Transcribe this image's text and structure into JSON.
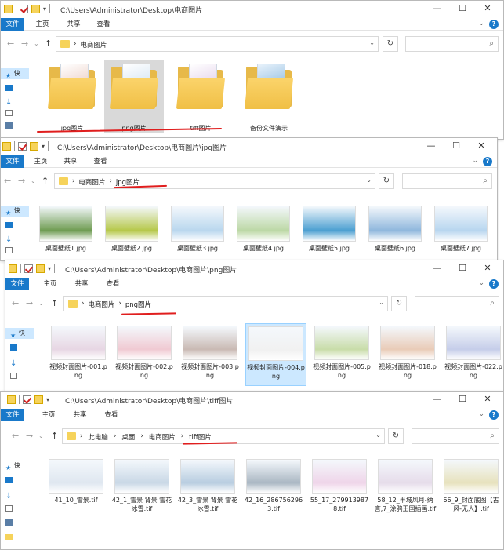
{
  "ribbon": {
    "file": "文件",
    "home": "主页",
    "share": "共享",
    "view": "查看",
    "help": "?"
  },
  "window1": {
    "path": "C:\\Users\\Administrator\\Desktop\\电商图片",
    "crumbs": [
      "电商图片"
    ],
    "sidebar": [
      "快",
      "♯",
      "↓",
      "♯",
      "♯"
    ],
    "folders": [
      {
        "label": "jpg图片"
      },
      {
        "label": "png图片"
      },
      {
        "label": "tiff图片"
      },
      {
        "label": "备份文件演示"
      }
    ]
  },
  "window2": {
    "path": "C:\\Users\\Administrator\\Desktop\\电商图片\\jpg图片",
    "crumbs": [
      "电商图片",
      "jpg图片"
    ],
    "files": [
      "桌面壁纸1.jpg",
      "桌面壁纸2.jpg",
      "桌面壁纸3.jpg",
      "桌面壁纸4.jpg",
      "桌面壁纸5.jpg",
      "桌面壁纸6.jpg",
      "桌面壁纸7.jpg"
    ],
    "thumb_colors": [
      "#6f9c52",
      "#b6c84a",
      "#b9d7ee",
      "#bcd8a5",
      "#4c9fd1",
      "#8fb7dd",
      "#b8d6ef"
    ]
  },
  "window3": {
    "path": "C:\\Users\\Administrator\\Desktop\\电商图片\\png图片",
    "crumbs": [
      "电商图片",
      "png图片"
    ],
    "files": [
      "视频封面图片-001.png",
      "视频封面图片-002.png",
      "视频封面图片-003.png",
      "视频封面图片-004.png",
      "视频封面图片-005.png",
      "视频封面图片-018.png",
      "视频封面图片-022.png"
    ],
    "thumb_colors": [
      "#e7d6e3",
      "#f0c9d2",
      "#c9b9b3",
      "#f1f1f1",
      "#c8dca8",
      "#e9cbb7",
      "#c5cde9"
    ]
  },
  "window4": {
    "path": "C:\\Users\\Administrator\\Desktop\\电商图片\\tiff图片",
    "crumbs": [
      "此电脑",
      "桌面",
      "电商图片",
      "tiff图片"
    ],
    "files": [
      "41_10_雪景.tif",
      "42_1_雪景 背景 雪花 冰雪.tif",
      "42_3_雪景 背景 雪花 冰雪.tif",
      "42_16_2867562963.tif",
      "55_17_2799139878.tif",
      "58_12_半城风月-纳言,7_涂鸦王国插画.tif",
      "66_9_封面底图【古风-无人】.tif"
    ],
    "thumb_colors": [
      "#dfe7f0",
      "#c9d8e6",
      "#b8cde0",
      "#aab7c3",
      "#efd5e9",
      "#e6dcea",
      "#e7e2bd"
    ]
  },
  "colors": {
    "accent": "#1979ca",
    "underline": "#e01e1e",
    "selected": "#cce8ff"
  }
}
